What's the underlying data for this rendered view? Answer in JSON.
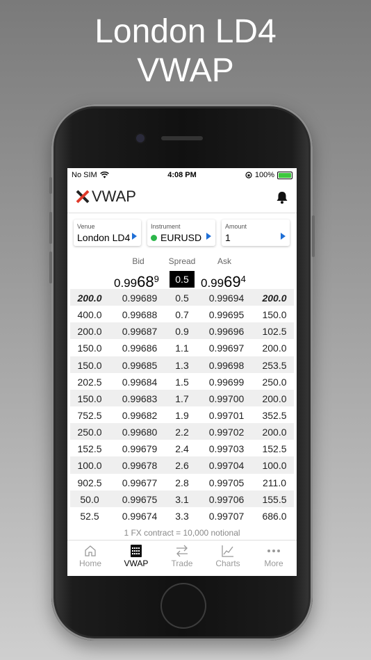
{
  "headline": {
    "line1": "London LD4",
    "line2": "VWAP"
  },
  "status_bar": {
    "carrier": "No SIM",
    "time": "4:08 PM",
    "battery": "100%"
  },
  "app": {
    "title": "VWAP"
  },
  "selectors": {
    "venue": {
      "label": "Venue",
      "value": "London LD4"
    },
    "instrument": {
      "label": "Instrument",
      "value": "EURUSD",
      "status_color": "#2cb64a"
    },
    "amount": {
      "label": "Amount",
      "value": "1"
    }
  },
  "columns": {
    "bid": "Bid",
    "spread": "Spread",
    "ask": "Ask"
  },
  "best": {
    "bid_prefix": "0.99",
    "bid_big": "68",
    "bid_sup": "9",
    "spread": "0.5",
    "ask_prefix": "0.99",
    "ask_big": "69",
    "ask_sup": "4"
  },
  "depth_rows": [
    [
      "200.0",
      "0.99689",
      "0.5",
      "0.99694",
      "200.0"
    ],
    [
      "400.0",
      "0.99688",
      "0.7",
      "0.99695",
      "150.0"
    ],
    [
      "200.0",
      "0.99687",
      "0.9",
      "0.99696",
      "102.5"
    ],
    [
      "150.0",
      "0.99686",
      "1.1",
      "0.99697",
      "200.0"
    ],
    [
      "150.0",
      "0.99685",
      "1.3",
      "0.99698",
      "253.5"
    ],
    [
      "202.5",
      "0.99684",
      "1.5",
      "0.99699",
      "250.0"
    ],
    [
      "150.0",
      "0.99683",
      "1.7",
      "0.99700",
      "200.0"
    ],
    [
      "752.5",
      "0.99682",
      "1.9",
      "0.99701",
      "352.5"
    ],
    [
      "250.0",
      "0.99680",
      "2.2",
      "0.99702",
      "200.0"
    ],
    [
      "152.5",
      "0.99679",
      "2.4",
      "0.99703",
      "152.5"
    ],
    [
      "100.0",
      "0.99678",
      "2.6",
      "0.99704",
      "100.0"
    ],
    [
      "902.5",
      "0.99677",
      "2.8",
      "0.99705",
      "211.0"
    ],
    [
      "50.0",
      "0.99675",
      "3.1",
      "0.99706",
      "155.5"
    ],
    [
      "52.5",
      "0.99674",
      "3.3",
      "0.99707",
      "686.0"
    ]
  ],
  "footnote": "1 FX contract = 10,000 notional",
  "tabs": [
    {
      "label": "Home",
      "icon": "home-icon",
      "active": false
    },
    {
      "label": "VWAP",
      "icon": "calculator-icon",
      "active": true
    },
    {
      "label": "Trade",
      "icon": "swap-arrows-icon",
      "active": false
    },
    {
      "label": "Charts",
      "icon": "line-chart-icon",
      "active": false
    },
    {
      "label": "More",
      "icon": "more-dots-icon",
      "active": false
    }
  ],
  "colors": {
    "accent_blue": "#1f6fd6",
    "logo_red": "#e03a2a"
  }
}
